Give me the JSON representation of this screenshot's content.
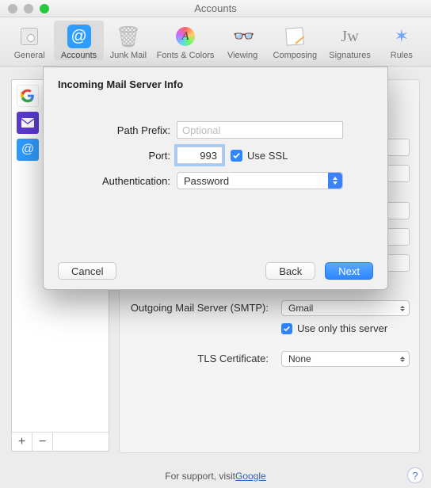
{
  "window": {
    "title": "Accounts"
  },
  "toolbar": {
    "items": [
      {
        "label": "General"
      },
      {
        "label": "Accounts"
      },
      {
        "label": "Junk Mail"
      },
      {
        "label": "Fonts & Colors"
      },
      {
        "label": "Viewing"
      },
      {
        "label": "Composing"
      },
      {
        "label": "Signatures"
      },
      {
        "label": "Rules"
      }
    ]
  },
  "sheet": {
    "title": "Incoming Mail Server Info",
    "path_prefix_label": "Path Prefix:",
    "path_prefix_placeholder": "Optional",
    "path_prefix_value": "",
    "port_label": "Port:",
    "port_value": "993",
    "use_ssl_label": "Use SSL",
    "use_ssl_checked": true,
    "auth_label": "Authentication:",
    "auth_value": "Password",
    "cancel": "Cancel",
    "back": "Back",
    "next": "Next"
  },
  "right_panel": {
    "smtp_label": "Outgoing Mail Server (SMTP):",
    "smtp_value": "Gmail",
    "use_only_label": "Use only this server",
    "tls_label": "TLS Certificate:",
    "tls_value": "None"
  },
  "footer": {
    "prefix": "For support, visit ",
    "link": "Google"
  },
  "sidebar": {
    "add": "+",
    "remove": "−"
  }
}
